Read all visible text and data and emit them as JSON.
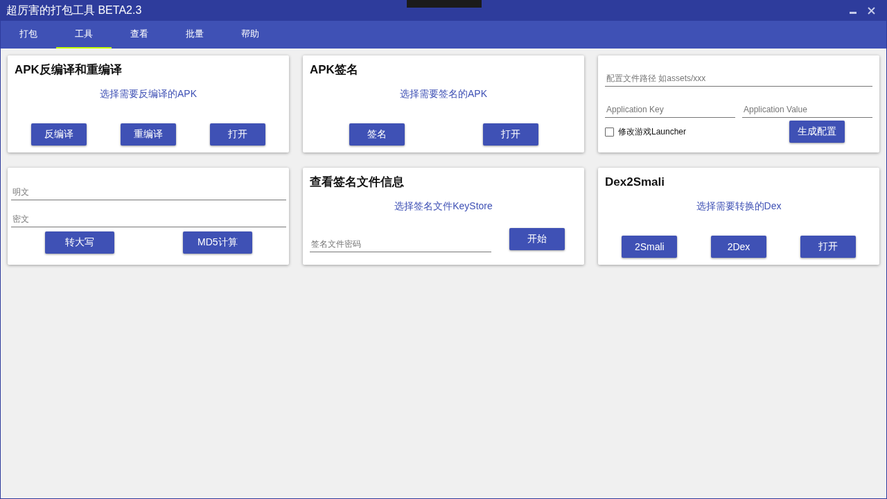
{
  "window": {
    "title": "超厉害的打包工具 BETA2.3"
  },
  "tabs": [
    {
      "label": "打包",
      "selected": false
    },
    {
      "label": "工具",
      "selected": true
    },
    {
      "label": "查看",
      "selected": false
    },
    {
      "label": "批量",
      "selected": false
    },
    {
      "label": "帮助",
      "selected": false
    }
  ],
  "cards": [
    {
      "kind": "picker",
      "title": "APK反编译和重编译",
      "link": "选择需要反编译的APK",
      "buttons": [
        "反编译",
        "重编译",
        "打开"
      ]
    },
    {
      "kind": "picker",
      "title": "APK签名",
      "link": "选择需要签名的APK",
      "buttons": [
        "签名",
        "打开"
      ]
    },
    {
      "kind": "config",
      "path_placeholder": "配置文件路径 如assets/xxx",
      "key_placeholder": "Application Key",
      "value_placeholder": "Application Value",
      "checkbox": {
        "label": "修改游戏Launcher",
        "checked": false
      },
      "button": "生成配置"
    },
    {
      "kind": "crypto",
      "fields": [
        {
          "placeholder": "明文"
        },
        {
          "placeholder": "密文"
        }
      ],
      "buttons": [
        "转大写",
        "MD5计算"
      ]
    },
    {
      "kind": "keystore",
      "title": "查看签名文件信息",
      "link": "选择签名文件KeyStore",
      "placeholder": "签名文件密码",
      "button": "开始"
    },
    {
      "kind": "picker",
      "title": "Dex2Smali",
      "link": "选择需要转换的Dex",
      "buttons": [
        "2Smali",
        "2Dex",
        "打开"
      ]
    }
  ]
}
